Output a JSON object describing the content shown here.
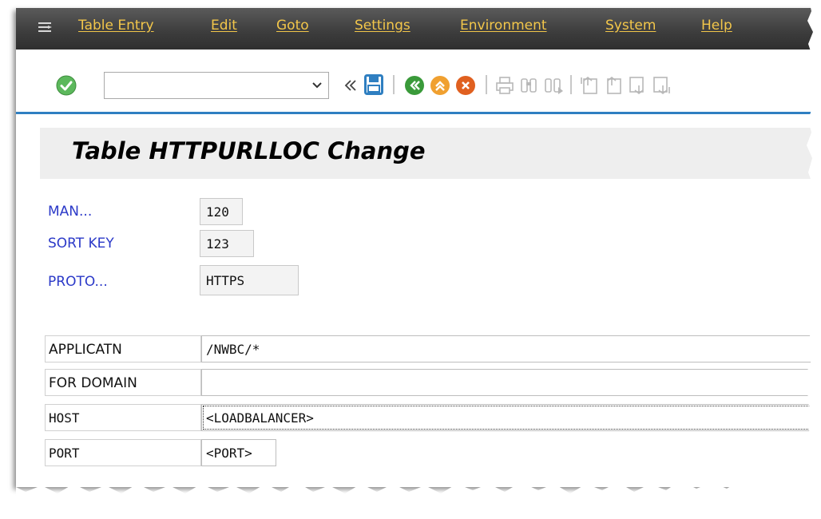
{
  "menu": {
    "items": [
      "Table Entry",
      "Edit",
      "Goto",
      "Settings",
      "Environment",
      "System",
      "Help"
    ]
  },
  "toolbar": {
    "command_field_value": "",
    "icons": [
      "enter-check-icon",
      "command-dropdown-icon",
      "collapse-icon",
      "save-icon",
      "back-icon",
      "exit-icon",
      "cancel-icon",
      "print-icon",
      "find-icon",
      "find-next-icon",
      "first-page-icon",
      "previous-page-icon",
      "next-page-icon",
      "last-page-icon"
    ],
    "colors": {
      "enter": "#5cb85c",
      "back": "#3a9a3a",
      "exit": "#f0a030",
      "cancel": "#e06020",
      "save": "#2f7fc1"
    }
  },
  "header": {
    "title": "Table HTTPURLLOC Change"
  },
  "keys": [
    {
      "label": "MAN...",
      "value": "120"
    },
    {
      "label": "SORT KEY",
      "value": "123"
    },
    {
      "label": "PROTO...",
      "value": "HTTPS"
    }
  ],
  "fields": [
    {
      "label": "APPLICATN",
      "value": "/NWBC/*"
    },
    {
      "label": "FOR DOMAIN",
      "value": ""
    },
    {
      "label": "HOST",
      "value": "<LOADBALANCER>"
    },
    {
      "label": "PORT",
      "value": "<PORT>"
    }
  ]
}
